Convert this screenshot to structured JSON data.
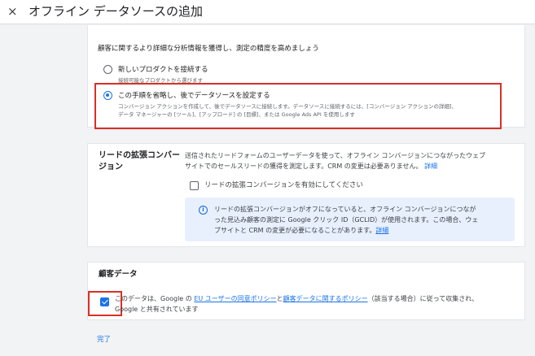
{
  "header": {
    "close_icon": "×",
    "title": "オフライン データソースの追加"
  },
  "options_card": {
    "intro": "顧客に関するより詳細な分析情報を獲得し、測定の精度を高めましょう",
    "option1": {
      "title": "新しいプロダクトを接続する",
      "subtitle": "接続可能なプロダクトから選びます",
      "selected": false
    },
    "option2": {
      "title": "この手順を省略し、後でデータソースを設定する",
      "line1": "コンバージョン アクションを作成して、後でデータソースに接続します。データソースに接続するには、[コンバージョン アクションの詳細]、",
      "line2": "データ マネージャーの [ツール]、[アップロード] の [目標]、または Google Ads API を使用します",
      "selected": true
    }
  },
  "enhanced_card": {
    "title_line1": "リードの拡張コンバー",
    "title_line2": "ジョン",
    "desc_line1": "送信されたリードフォームのユーザーデータを使って、オフライン コンバージョンにつながったウェブ",
    "desc_line2": "サイトでのセールスリードの獲得を測定します。CRM の変更は必要ありません。",
    "desc_link": "詳細",
    "checkbox_label": "リードの拡張コンバージョンを有効にしてください",
    "checkbox_checked": false,
    "info_icon": "i",
    "info_line1": "リードの拡張コンバージョンがオフになっていると、オフライン コンバージョンにつなが",
    "info_line2": "った見込み顧客の測定に Google クリック ID（GCLID）が使用されます。この場合、ウェ",
    "info_line3": "ブサイトと CRM の変更が必要になることがあります。",
    "info_link": "詳細"
  },
  "customer_card": {
    "title": "顧客データ",
    "checkbox_checked": true,
    "text_pre": "このデータは、Google の",
    "link1": "EU ユーザーの同意ポリシー",
    "text_mid": "と",
    "link2": "顧客データに関するポリシー",
    "text_post": "（該当する場合）に従って収集され、",
    "line2": "Google と共有されています"
  },
  "footer": {
    "done_label": "完了"
  },
  "colors": {
    "accent": "#1a73e8",
    "highlight": "#d93025",
    "info_bg": "#e8f0fe"
  }
}
